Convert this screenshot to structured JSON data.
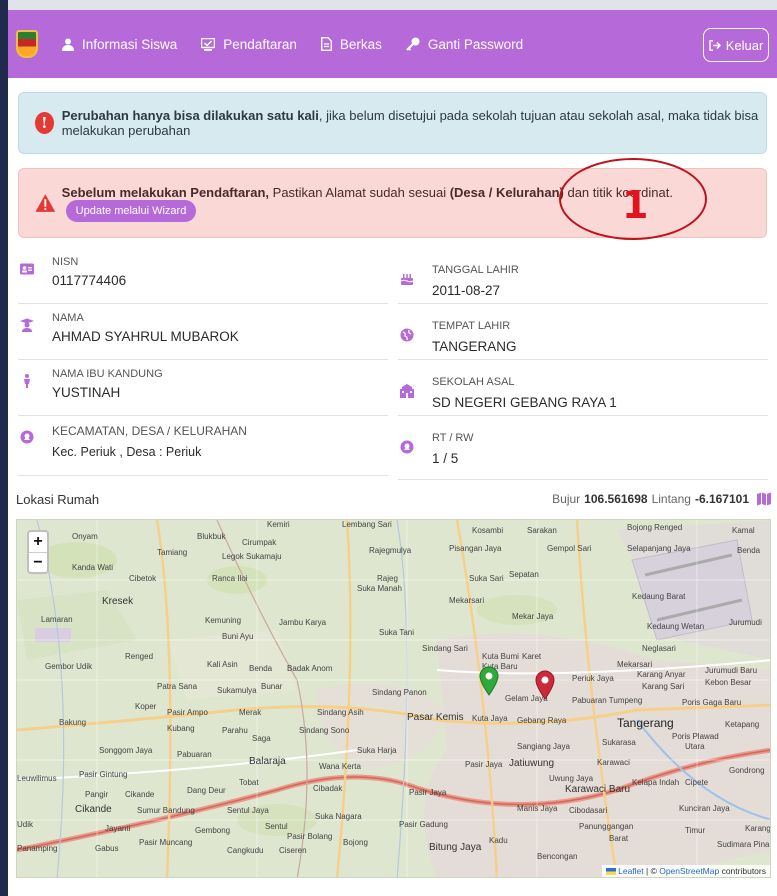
{
  "navbar": {
    "items": [
      {
        "label": "Informasi Siswa",
        "icon": "user-icon"
      },
      {
        "label": "Pendaftaran",
        "icon": "monitor-icon"
      },
      {
        "label": "Berkas",
        "icon": "file-icon"
      },
      {
        "label": "Ganti Password",
        "icon": "key-icon"
      }
    ],
    "logout_label": "Keluar"
  },
  "alert_info": {
    "bold": "Perubahan hanya bisa dilakukan satu kali",
    "text": ", jika belum disetujui pada sekolah tujuan atau sekolah asal, maka tidak bisa melakukan perubahan"
  },
  "alert_danger": {
    "bold1": "Sebelum melakukan Pendaftaran,",
    "text1": " Pastikan Alamat sudah sesuai ",
    "bold2": "(Desa / Kelurahan)",
    "text2": " dan titik koordinat.",
    "button": "Update melalui Wizard"
  },
  "annotation": {
    "number": "1",
    "color": "#e0141f"
  },
  "student": {
    "left": [
      {
        "label": "NISN",
        "value": "0117774406",
        "icon": "id-card-icon"
      },
      {
        "label": "NAMA",
        "value": "AHMAD SYAHRUL MUBAROK",
        "icon": "graduate-icon"
      },
      {
        "label": "NAMA IBU KANDUNG",
        "value": "YUSTINAH",
        "icon": "person-icon"
      },
      {
        "label": "KECAMATAN, DESA / KELURAHAN",
        "value": "Kec. Periuk , Desa : Periuk",
        "icon": "location-icon"
      }
    ],
    "right": [
      {
        "label": "TANGGAL LAHIR",
        "value": "2011-08-27",
        "icon": "birthday-cake-icon"
      },
      {
        "label": "TEMPAT LAHIR",
        "value": "TANGERANG",
        "icon": "globe-icon"
      },
      {
        "label": "SEKOLAH ASAL",
        "value": "SD NEGERI GEBANG RAYA 1",
        "icon": "school-icon"
      },
      {
        "label": "RT / RW",
        "value": "1 / 5",
        "icon": "location-icon"
      }
    ]
  },
  "location": {
    "title": "Lokasi Rumah",
    "bujur_label": "Bujur",
    "bujur": "106.561698",
    "lintang_label": "Lintang",
    "lintang": "-6.167101"
  },
  "map": {
    "zoom_in": "+",
    "zoom_out": "−",
    "attribution_leaflet": "Leaflet",
    "attribution_sep": " | © ",
    "attribution_osm": "OpenStreetMap",
    "attribution_tail": " contributors",
    "places": [
      {
        "name": "Kemiri"
      },
      {
        "name": "Lembang Sari"
      },
      {
        "name": "Kosambi"
      },
      {
        "name": "Sarakan"
      },
      {
        "name": "Bojong Renged"
      },
      {
        "name": "Kamal"
      },
      {
        "name": "Onyam"
      },
      {
        "name": "Blukbuk"
      },
      {
        "name": "Cirumpak"
      },
      {
        "name": "Tamiang"
      },
      {
        "name": "Legok Sukamaju"
      },
      {
        "name": "Rajegmulya"
      },
      {
        "name": "Pisangan Jaya"
      },
      {
        "name": "Gempol Sari"
      },
      {
        "name": "Selapanjang Jaya"
      },
      {
        "name": "Benda"
      },
      {
        "name": "Kanda Wati"
      },
      {
        "name": "Cibetok"
      },
      {
        "name": "Ranca Iloi"
      },
      {
        "name": "Rajeg"
      },
      {
        "name": "Suka Manah"
      },
      {
        "name": "Suka Sari"
      },
      {
        "name": "Sepatan"
      },
      {
        "name": "Kresek"
      },
      {
        "name": "Mekarsari"
      },
      {
        "name": "Kedaung Barat"
      },
      {
        "name": "Lamaran"
      },
      {
        "name": "Kemuning"
      },
      {
        "name": "Jambu Karya"
      },
      {
        "name": "Mekar Jaya"
      },
      {
        "name": "Buni Ayu"
      },
      {
        "name": "Suka Tani"
      },
      {
        "name": "Kedaung Wetan"
      },
      {
        "name": "Jurumudi"
      },
      {
        "name": "Gembor Udik"
      },
      {
        "name": "Renged"
      },
      {
        "name": "Kali Asin"
      },
      {
        "name": "Benda"
      },
      {
        "name": "Badak Anom"
      },
      {
        "name": "Sindang Sari"
      },
      {
        "name": "Kuta Bumi"
      },
      {
        "name": "Karet"
      },
      {
        "name": "Neglasari"
      },
      {
        "name": "Jurumudi Baru"
      },
      {
        "name": "Patra Sana"
      },
      {
        "name": "Sukamulya"
      },
      {
        "name": "Bunar"
      },
      {
        "name": "Kuta Baru"
      },
      {
        "name": "Mekarsari"
      },
      {
        "name": "Karang Anyar"
      },
      {
        "name": "Kebon Besar"
      },
      {
        "name": "Sindang Panon"
      },
      {
        "name": "Periuk Jaya"
      },
      {
        "name": "Karang Sari"
      },
      {
        "name": "Koper"
      },
      {
        "name": "Pasir Ampo"
      },
      {
        "name": "Merak"
      },
      {
        "name": "Sindang Asih"
      },
      {
        "name": "Gelam Jaya"
      },
      {
        "name": "Pabuaran Tumpeng"
      },
      {
        "name": "Poris Gaga Baru"
      },
      {
        "name": "Bakung"
      },
      {
        "name": "Kubang"
      },
      {
        "name": "Parahu"
      },
      {
        "name": "Saga"
      },
      {
        "name": "Sindang Sono"
      },
      {
        "name": "Pasar Kemis"
      },
      {
        "name": "Kuta Jaya"
      },
      {
        "name": "Gebang Raya"
      },
      {
        "name": "Tangerang"
      },
      {
        "name": "Ketapang"
      },
      {
        "name": "Songgom Jaya"
      },
      {
        "name": "Pabuaran"
      },
      {
        "name": "Suka Harja"
      },
      {
        "name": "Sangiang Jaya"
      },
      {
        "name": "Sukarasa"
      },
      {
        "name": "Poris Plawad"
      },
      {
        "name": "Utara"
      },
      {
        "name": "Balaraja"
      },
      {
        "name": "Wana Kerta"
      },
      {
        "name": "Pasir Jaya"
      },
      {
        "name": "Jatiuwung"
      },
      {
        "name": "Karawaci"
      },
      {
        "name": "Gondrong"
      },
      {
        "name": "Leuwilimus"
      },
      {
        "name": "Pasir Gintung"
      },
      {
        "name": "Tobat"
      },
      {
        "name": "Cibadak"
      },
      {
        "name": "Uwung Jaya"
      },
      {
        "name": "Karawaci Baru"
      },
      {
        "name": "Kelapa Indah"
      },
      {
        "name": "Cipete"
      },
      {
        "name": "Pangir"
      },
      {
        "name": "Cikande"
      },
      {
        "name": "Dang Deur"
      },
      {
        "name": "Pasir Jaya"
      },
      {
        "name": "Cikande"
      },
      {
        "name": "Sumur Bandung"
      },
      {
        "name": "Sentul Jaya"
      },
      {
        "name": "Suka Nagara"
      },
      {
        "name": "Manis Jaya"
      },
      {
        "name": "Cibodasari"
      },
      {
        "name": "Kunciran Jaya"
      },
      {
        "name": "Udik"
      },
      {
        "name": "Jayanti"
      },
      {
        "name": "Gembong"
      },
      {
        "name": "Sentul"
      },
      {
        "name": "Pasir Gadung"
      },
      {
        "name": "Panunggangan"
      },
      {
        "name": "Timur"
      },
      {
        "name": "Karang"
      },
      {
        "name": "Panamping"
      },
      {
        "name": "Gabus"
      },
      {
        "name": "Pasir Muncang"
      },
      {
        "name": "Cangkudu"
      },
      {
        "name": "Ciseren"
      },
      {
        "name": "Pasir Bolang"
      },
      {
        "name": "Bojong"
      },
      {
        "name": "Bitung Jaya"
      },
      {
        "name": "Kadu"
      },
      {
        "name": "Bencongan"
      },
      {
        "name": "Sudimara Pinang"
      },
      {
        "name": "Barat"
      }
    ],
    "marker_colors": {
      "green": "#2eaa3a",
      "red": "#cc2a3b"
    }
  },
  "colors": {
    "accent": "#b66ad9",
    "danger_bg": "#f9d8d6",
    "info_bg": "#d7eaf0"
  }
}
